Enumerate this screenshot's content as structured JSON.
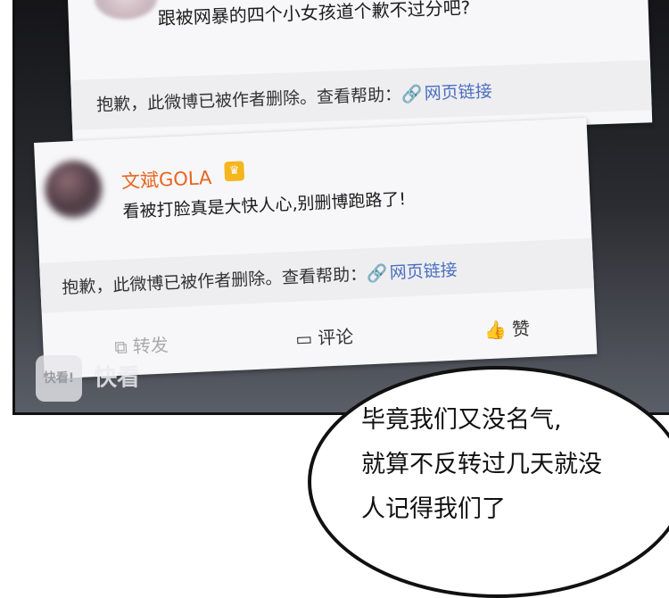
{
  "top_card": {
    "comment": "跟被网暴的四个小女孩道个歉不过分吧?",
    "deleted_notice": "抱歉，此微博已被作者删除。查看帮助：",
    "link_label": "网页链接"
  },
  "front_card": {
    "username": "文斌GOLA",
    "badge_icon": "crown-icon",
    "comment": "看被打脸真是大快人心,别删博跑路了!",
    "deleted_notice": "抱歉，此微博已被作者删除。查看帮助：",
    "link_label": "网页链接",
    "actions": {
      "repost": "转发",
      "comment": "评论",
      "like": "赞"
    }
  },
  "watermark": {
    "badge": "快看!",
    "text": "快看"
  },
  "speech_bubble": {
    "lines": [
      "毕竟我们又没名气,",
      "就算不反转过几天就没",
      "人记得我们了"
    ]
  },
  "colors": {
    "username": "#e8641e",
    "link": "#4a6fc0",
    "panel_dark": "#151518"
  }
}
